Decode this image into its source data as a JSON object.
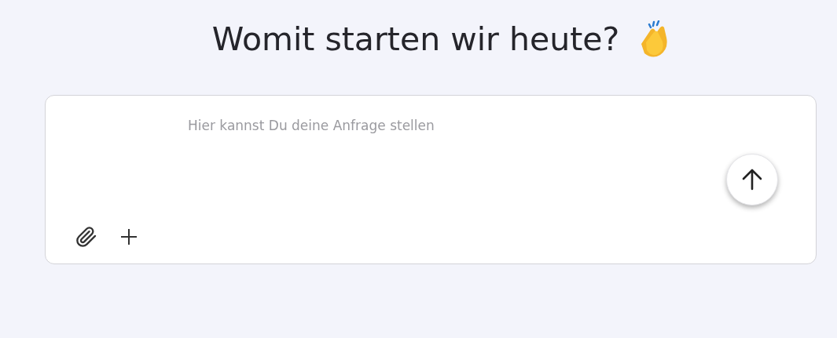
{
  "heading": {
    "title": "Womit starten wir heute?"
  },
  "prompt": {
    "placeholder": "Hier kannst Du deine Anfrage stellen"
  }
}
